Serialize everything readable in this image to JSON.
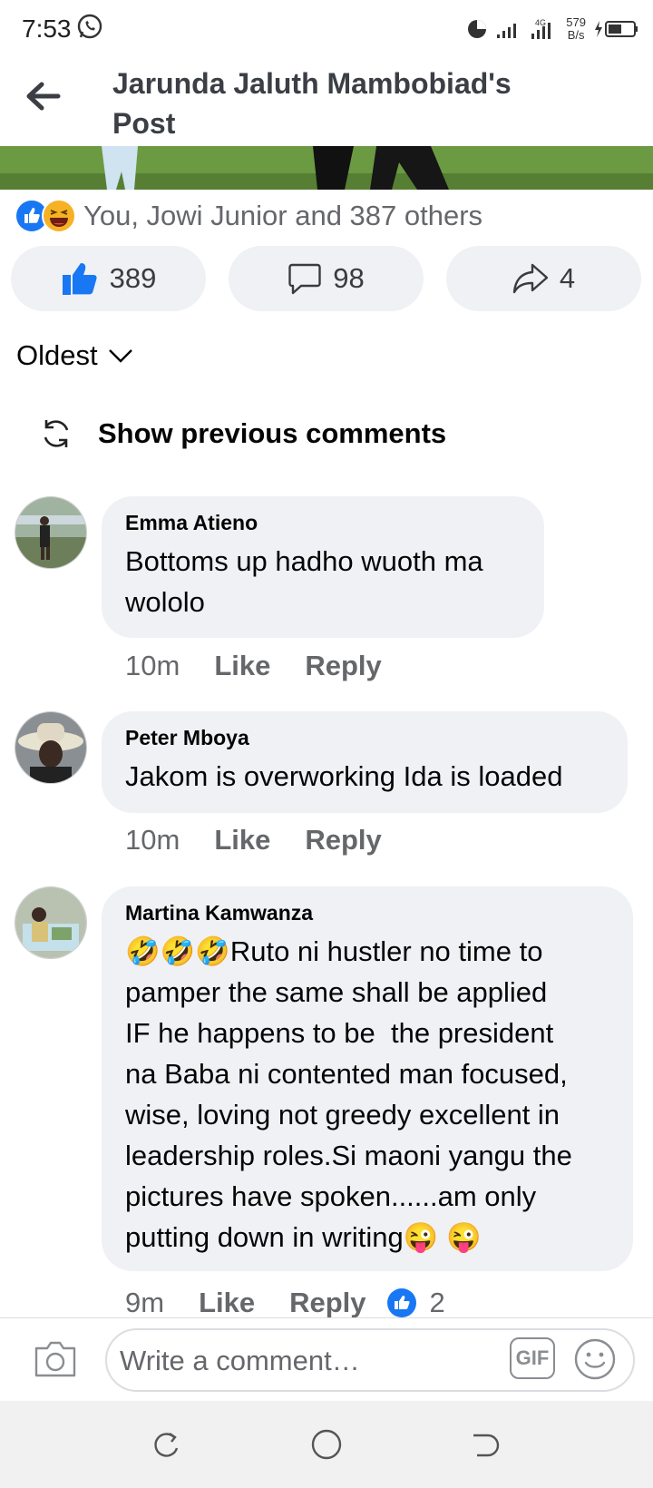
{
  "status": {
    "time": "7:53",
    "net_speed": "579",
    "net_unit": "B/s",
    "network": "4G"
  },
  "header": {
    "title_line1": "Jarunda Jaluth Mambobiad's",
    "title_line2": "Post"
  },
  "reactions": {
    "summary": "You, Jowi Junior and 387 others"
  },
  "actions": {
    "likes": "389",
    "comments": "98",
    "shares": "4"
  },
  "sort": {
    "label": "Oldest"
  },
  "previous": {
    "label": "Show previous comments"
  },
  "comments": [
    {
      "name": "Emma Atieno",
      "text_line1": "Bottoms up hadho wuoth ma",
      "text_line2": "wololo",
      "time": "10m",
      "like": "Like",
      "reply": "Reply"
    },
    {
      "name": "Peter Mboya",
      "text_line1": "Jakom is overworking Ida is loaded",
      "time": "10m",
      "like": "Like",
      "reply": "Reply"
    },
    {
      "name": "Martina Kamwanza",
      "lines": [
        "Ruto ni hustler no time to",
        "pamper the same shall be applied",
        "IF he happens to be  the president",
        "na Baba ni contented man focused,",
        "wise, loving not greedy excellent in",
        "leadership roles.Si maoni yangu the",
        "pictures have spoken......am only",
        "putting down in writing"
      ],
      "time": "9m",
      "like": "Like",
      "reply": "Reply",
      "like_count": "2"
    }
  ],
  "composer": {
    "placeholder": "Write a comment…",
    "gif": "GIF"
  },
  "colors": {
    "accent": "#1877f2",
    "bubble": "#eff1f4",
    "muted": "#65676b"
  }
}
